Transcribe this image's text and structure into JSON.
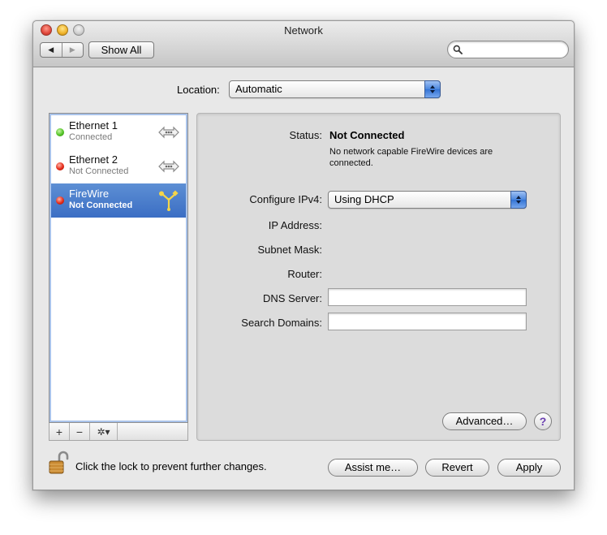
{
  "window": {
    "title": "Network"
  },
  "toolbar": {
    "back_glyph": "◀",
    "forward_glyph": "▶",
    "show_all_label": "Show All",
    "search_placeholder": "",
    "search_icon": "search-icon"
  },
  "location": {
    "label": "Location:",
    "value": "Automatic"
  },
  "services": [
    {
      "name": "Ethernet 1",
      "status": "Connected",
      "status_color": "green",
      "icon": "ethernet-icon",
      "selected": false
    },
    {
      "name": "Ethernet 2",
      "status": "Not Connected",
      "status_color": "red",
      "icon": "ethernet-icon",
      "selected": false
    },
    {
      "name": "FireWire",
      "status": "Not Connected",
      "status_color": "red",
      "icon": "firewire-icon",
      "selected": true
    }
  ],
  "sidebar_toolbar": {
    "add": "+",
    "remove": "−",
    "action": "✲▾"
  },
  "detail": {
    "status_label": "Status:",
    "status_value": "Not Connected",
    "status_description": "No network capable FireWire devices are connected.",
    "configure_label": "Configure IPv4:",
    "configure_value": "Using DHCP",
    "ip_label": "IP Address:",
    "subnet_label": "Subnet Mask:",
    "router_label": "Router:",
    "dns_label": "DNS Server:",
    "dns_value": "",
    "search_domains_label": "Search Domains:",
    "search_domains_value": "",
    "advanced_label": "Advanced…",
    "help_label": "?"
  },
  "footer": {
    "lock_text": "Click the lock to prevent further changes.",
    "assist_label": "Assist me…",
    "revert_label": "Revert",
    "apply_label": "Apply"
  },
  "colors": {
    "selection": "#3b6ec4",
    "popup_arrow": "#4a86de",
    "status_connected": "#52c325",
    "status_disconnected": "#e52a18"
  }
}
